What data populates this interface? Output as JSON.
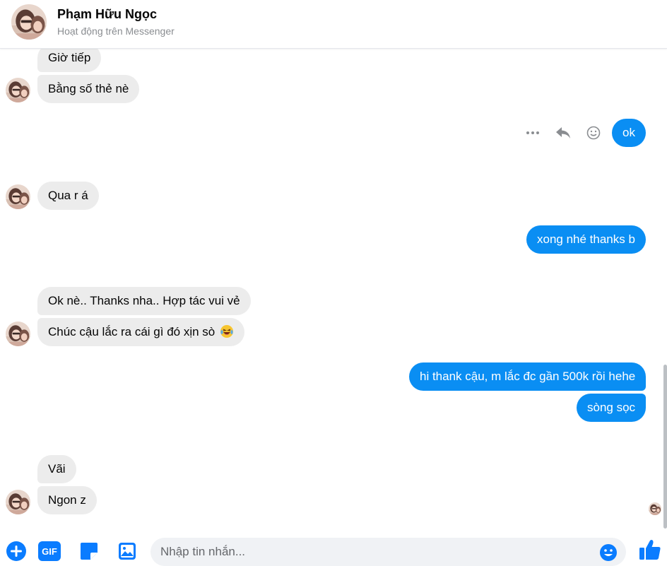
{
  "header": {
    "contact_name": "Phạm Hữu Ngọc",
    "status": "Hoạt động trên Messenger"
  },
  "messages": [
    {
      "from": "them",
      "text": "Giờ tiếp"
    },
    {
      "from": "them",
      "text": "Bằng số thẻ nè"
    },
    {
      "from": "me",
      "text": "ok"
    },
    {
      "from": "them",
      "text": "Qua r á"
    },
    {
      "from": "me",
      "text": "xong nhé thanks b"
    },
    {
      "from": "them",
      "text": "Ok nè.. Thanks nha.. Hợp tác vui vẻ"
    },
    {
      "from": "them",
      "text": "Chúc cậu lắc ra cái gì đó xịn sò",
      "emoji": "laughing-with-tears-emoji"
    },
    {
      "from": "me",
      "text": "hi thank cậu, m lắc đc gần 500k rồi hehe"
    },
    {
      "from": "me",
      "text": "sòng sọc"
    },
    {
      "from": "them",
      "text": "Vãi"
    },
    {
      "from": "them",
      "text": "Ngon z"
    }
  ],
  "message_actions": {
    "icons": [
      "more-options-icon",
      "reply-icon",
      "react-smiley-icon"
    ]
  },
  "composer": {
    "placeholder": "Nhập tin nhắn...",
    "tools": [
      "add-icon",
      "gif-icon",
      "sticker-icon",
      "photo-icon"
    ],
    "send_icon": "thumbs-up-icon"
  },
  "colors": {
    "outgoing_bubble": "#0a8ef3",
    "incoming_bubble": "#ececec",
    "accent": "#0a7cff"
  }
}
